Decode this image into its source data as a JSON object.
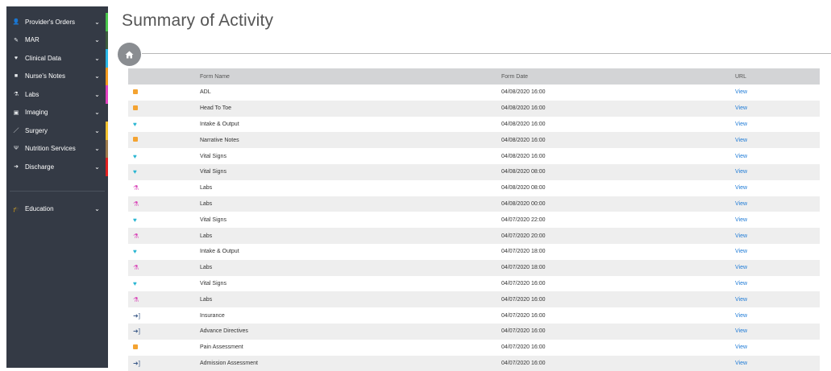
{
  "sidebar": {
    "items": [
      {
        "label": "Provider's Orders",
        "icon": "user-md-icon",
        "accent": "#47c44a"
      },
      {
        "label": "MAR",
        "icon": "pill-icon",
        "accent": "#3c5b3c"
      },
      {
        "label": "Clinical Data",
        "icon": "heartbeat-icon",
        "accent": "#29b6e6"
      },
      {
        "label": "Nurse's Notes",
        "icon": "sticky-note-icon",
        "accent": "#f39a1f"
      },
      {
        "label": "Labs",
        "icon": "flask-icon",
        "accent": "#e040c0"
      },
      {
        "label": "Imaging",
        "icon": "image-icon",
        "accent": "#343a45"
      },
      {
        "label": "Surgery",
        "icon": "scalpel-icon",
        "accent": "#f2c12e"
      },
      {
        "label": "Nutrition Services",
        "icon": "cutlery-icon",
        "accent": "#9c7a4a"
      },
      {
        "label": "Discharge",
        "icon": "sign-out-icon",
        "accent": "#e02020"
      }
    ],
    "education": {
      "label": "Education",
      "icon": "graduation-cap-icon"
    }
  },
  "main": {
    "title": "Summary of Activity",
    "table": {
      "headers": [
        "Form Name",
        "Form Date",
        "URL"
      ],
      "rows": [
        {
          "type": "note",
          "name": "ADL",
          "date": "04/08/2020 16:00",
          "url": "View"
        },
        {
          "type": "note",
          "name": "Head To Toe",
          "date": "04/08/2020 16:00",
          "url": "View"
        },
        {
          "type": "heart",
          "name": "Intake & Output",
          "date": "04/08/2020 16:00",
          "url": "View"
        },
        {
          "type": "note",
          "name": "Narrative Notes",
          "date": "04/08/2020 16:00",
          "url": "View"
        },
        {
          "type": "heart",
          "name": "Vital Signs",
          "date": "04/08/2020 16:00",
          "url": "View"
        },
        {
          "type": "heart",
          "name": "Vital Signs",
          "date": "04/08/2020 08:00",
          "url": "View"
        },
        {
          "type": "flask",
          "name": "Labs",
          "date": "04/08/2020 08:00",
          "url": "View"
        },
        {
          "type": "flask",
          "name": "Labs",
          "date": "04/08/2020 00:00",
          "url": "View"
        },
        {
          "type": "heart",
          "name": "Vital Signs",
          "date": "04/07/2020 22:00",
          "url": "View"
        },
        {
          "type": "flask",
          "name": "Labs",
          "date": "04/07/2020 20:00",
          "url": "View"
        },
        {
          "type": "heart",
          "name": "Intake & Output",
          "date": "04/07/2020 18:00",
          "url": "View"
        },
        {
          "type": "flask",
          "name": "Labs",
          "date": "04/07/2020 18:00",
          "url": "View"
        },
        {
          "type": "heart",
          "name": "Vital Signs",
          "date": "04/07/2020 16:00",
          "url": "View"
        },
        {
          "type": "flask",
          "name": "Labs",
          "date": "04/07/2020 16:00",
          "url": "View"
        },
        {
          "type": "signin",
          "name": "Insurance",
          "date": "04/07/2020 16:00",
          "url": "View"
        },
        {
          "type": "signin",
          "name": "Advance Directives",
          "date": "04/07/2020 16:00",
          "url": "View"
        },
        {
          "type": "note",
          "name": "Pain Assessment",
          "date": "04/07/2020 16:00",
          "url": "View"
        },
        {
          "type": "signin",
          "name": "Admission Assessment",
          "date": "04/07/2020 16:00",
          "url": "View"
        }
      ]
    }
  },
  "colors": {
    "link": "#1f7bd6",
    "note": "#f4a331",
    "heart": "#29b6d2",
    "flask": "#d946b8",
    "signin": "#3f5d8a"
  }
}
